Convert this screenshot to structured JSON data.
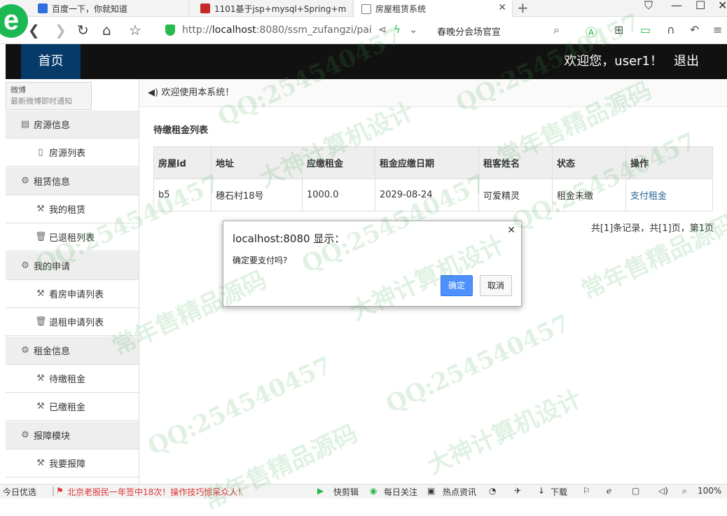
{
  "browser": {
    "tabs": [
      {
        "label": "百度一下，你就知道"
      },
      {
        "label": "1101基于jsp+mysql+Spring+m"
      },
      {
        "label": "房屋租赁系统"
      }
    ],
    "url_prefix": "http://",
    "url_host": "localhost",
    "url_rest": ":8080/ssm_zufangzi/pai",
    "news_link": "春晚分会场官宣"
  },
  "header": {
    "home_label": "首页",
    "welcome": "欢迎您，user1！",
    "logout": "退出"
  },
  "weibo_popup": {
    "title": "微博",
    "subtitle": "最新微博即时通知"
  },
  "sidebar": {
    "items": [
      {
        "label": "房源信息"
      },
      {
        "label": "房源列表"
      },
      {
        "label": "租赁信息"
      },
      {
        "label": "我的租赁"
      },
      {
        "label": "已退租列表"
      },
      {
        "label": "我的申请"
      },
      {
        "label": "看房申请列表"
      },
      {
        "label": "退租申请列表"
      },
      {
        "label": "租金信息"
      },
      {
        "label": "待缴租金"
      },
      {
        "label": "已缴租金"
      },
      {
        "label": "报障模块"
      },
      {
        "label": "我要报障"
      }
    ]
  },
  "main": {
    "breadcrumb": "欢迎使用本系统！",
    "panel_title": "待缴租金列表",
    "columns": [
      "房屋id",
      "地址",
      "应缴租金",
      "租金应缴日期",
      "租客姓名",
      "状态",
      "操作"
    ],
    "rows": [
      {
        "house_id": "b5",
        "address": "穗石村18号",
        "amount": "1000.0",
        "due_date": "2029-08-24",
        "tenant": "可爱精灵",
        "status": "租金未缴",
        "action": "支付租金"
      }
    ],
    "pager": "共[1]条记录，共[1]页，第1页"
  },
  "dialog": {
    "title": "localhost:8080 显示：",
    "message": "确定要支付吗?",
    "ok": "确定",
    "cancel": "取消"
  },
  "statusbar": {
    "left": "今日优选",
    "news": "北京老股民一年签中18次！操作技巧惊呆众人！",
    "quick_clip": "快剪辑",
    "daily": "每日关注",
    "hot": "热点资讯",
    "download": "下载",
    "zoom": "100%"
  },
  "watermarks": {
    "qq": "QQ:254540457",
    "design": "大神计算机设计",
    "source": "常年售精品源码"
  }
}
